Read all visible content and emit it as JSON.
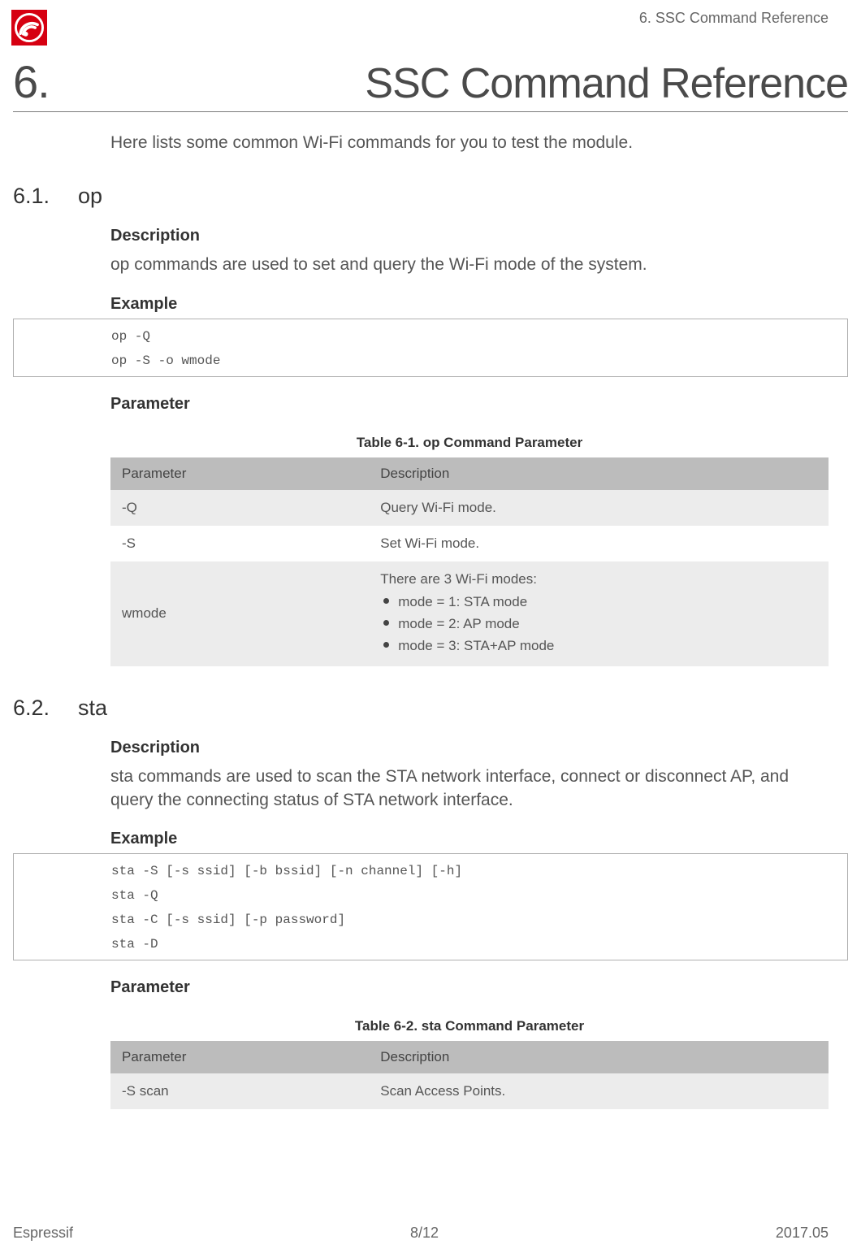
{
  "running_head": "6. SSC Command Reference",
  "chapter": {
    "num": "6.",
    "title": "SSC Command Reference"
  },
  "intro": "Here lists some common Wi-Fi commands for you to test the module.",
  "sections": {
    "op": {
      "num": "6.1.",
      "name": "op",
      "desc_h": "Description",
      "desc": "op commands are used to set and query the Wi-Fi mode of the system.",
      "example_h": "Example",
      "example_lines": {
        "l0": "op -Q",
        "l1": "op -S -o wmode"
      },
      "param_h": "Parameter",
      "table_caption": "Table 6-1. op Command Parameter",
      "table": {
        "head": {
          "c0": "Parameter",
          "c1": "Description"
        },
        "r0": {
          "c0": "-Q",
          "c1": "Query Wi-Fi mode."
        },
        "r1": {
          "c0": "-S",
          "c1": "Set Wi-Fi mode."
        },
        "r2": {
          "c0": "wmode",
          "lead": "There are 3 Wi-Fi modes:",
          "b0": "mode = 1: STA mode",
          "b1": "mode = 2: AP mode",
          "b2": "mode = 3: STA+AP mode"
        }
      }
    },
    "sta": {
      "num": "6.2.",
      "name": "sta",
      "desc_h": "Description",
      "desc": "sta commands are used to scan the STA network interface, connect or disconnect AP, and query the connecting status of STA network interface.",
      "example_h": "Example",
      "example_lines": {
        "l0": "sta -S [-s ssid] [-b bssid] [-n channel] [-h]",
        "l1": "sta -Q",
        "l2": "sta -C [-s ssid] [-p password]",
        "l3": "sta -D"
      },
      "param_h": "Parameter",
      "table_caption": "Table 6-2. sta Command Parameter",
      "table": {
        "head": {
          "c0": "Parameter",
          "c1": "Description"
        },
        "r0": {
          "c0": "-S scan",
          "c1": "Scan Access Points."
        }
      }
    }
  },
  "footer": {
    "left": "Espressif",
    "center": "8/12",
    "right": "2017.05"
  }
}
